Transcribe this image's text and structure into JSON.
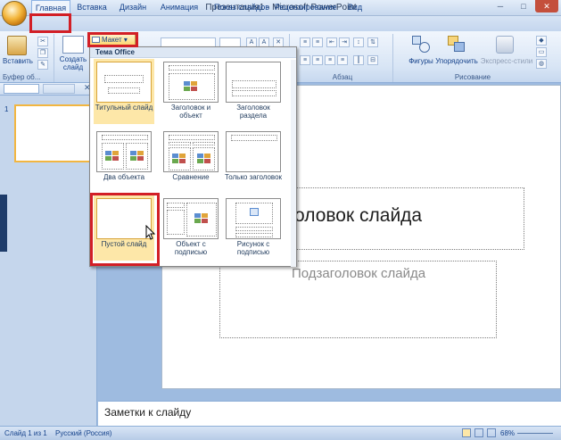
{
  "window": {
    "title": "Презентация1 - Microsoft PowerPoint",
    "controls": [
      "minimize-icon",
      "maximize-icon",
      "close-icon"
    ]
  },
  "qat": {
    "icons": [
      "save-icon",
      "undo-icon",
      "redo-icon",
      "customize-icon"
    ]
  },
  "tabs": [
    "Главная",
    "Вставка",
    "Дизайн",
    "Анимация",
    "Показ слайдов",
    "Рецензирование",
    "Вид"
  ],
  "ribbon": {
    "paste": "Вставить",
    "new_slide": "Создать слайд",
    "layout_button": "Макет",
    "groups": {
      "clipboard": "Буфер об...",
      "paragraph": "Абзац",
      "drawing": "Рисование"
    },
    "drawing_buttons": {
      "shapes": "Фигуры",
      "arrange": "Упорядочить",
      "quick_styles": "Экспресс-стили"
    }
  },
  "gallery": {
    "header": "Тема Office",
    "layouts": [
      {
        "label": "Титульный слайд",
        "selected": true
      },
      {
        "label": "Заголовок и объект",
        "selected": false
      },
      {
        "label": "Заголовок раздела",
        "selected": false
      },
      {
        "label": "Два объекта",
        "selected": false
      },
      {
        "label": "Сравнение",
        "selected": false
      },
      {
        "label": "Только заголовок",
        "selected": false
      },
      {
        "label": "Пустой слайд",
        "selected": false,
        "hovered": true
      },
      {
        "label": "Объект с подписью",
        "selected": false
      },
      {
        "label": "Рисунок с подписью",
        "selected": false
      }
    ]
  },
  "slide_panel": {
    "thumb_number": "1"
  },
  "slide": {
    "title": "оловок слайда",
    "subtitle": "Подзаголовок слайда"
  },
  "notes": "Заметки к слайду",
  "status": {
    "slide": "Слайд 1 из 1",
    "lang": "Русский (Россия)",
    "zoom": "68%"
  },
  "colors": {
    "highlight": "#d21f26",
    "selected_item": "#fde7a8",
    "dark_blue": "#1e3c6a"
  }
}
